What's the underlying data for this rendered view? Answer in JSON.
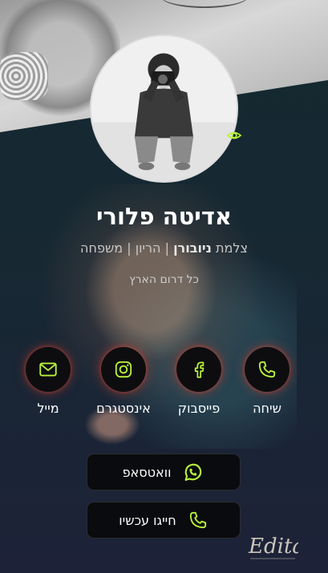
{
  "profile": {
    "name": "אדיטה פלורי",
    "subtitle_prefix": "צלמת",
    "subtitle_bold": "ניובורן",
    "subtitle_rest": "| הריון | משפחה",
    "location": "כל דרום הארץ"
  },
  "actions": [
    {
      "label": "שיחה",
      "icon": "phone-icon"
    },
    {
      "label": "פייסבוק",
      "icon": "facebook-icon"
    },
    {
      "label": "אינסטגרם",
      "icon": "instagram-icon"
    },
    {
      "label": "מייל",
      "icon": "mail-icon"
    }
  ],
  "buttons": {
    "whatsapp_label": "וואטסאפ",
    "call_label": "חייגו עכשיו"
  },
  "logo_text": "Edita",
  "colors": {
    "accent": "#b8f23a",
    "button_bg": "#0a0b0e",
    "glow": "#e63c28"
  }
}
